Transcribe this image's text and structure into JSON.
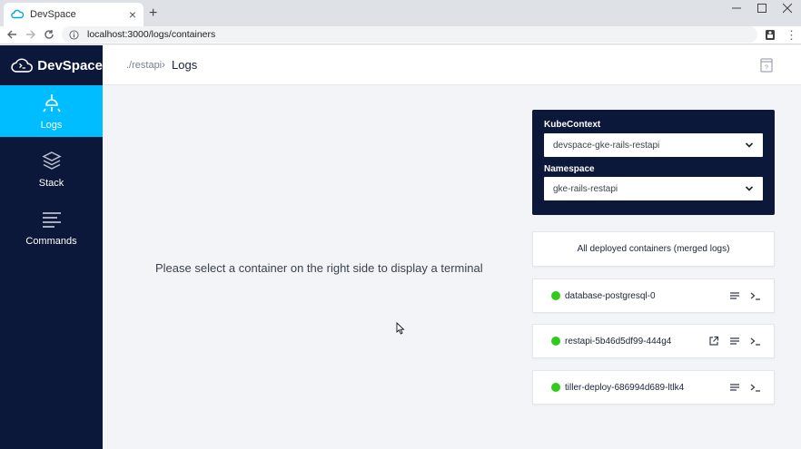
{
  "browser": {
    "tab_title": "DevSpace",
    "new_tab": "+",
    "url": "localhost:3000/logs/containers",
    "window_controls": [
      "minimize",
      "maximize",
      "close"
    ]
  },
  "app": {
    "brand": "DevSpace",
    "breadcrumb": {
      "parent": "./restapi",
      "separator": "›",
      "current": "Logs"
    },
    "sidebar": {
      "items": [
        {
          "label": "Logs",
          "icon": "logs-icon",
          "active": true
        },
        {
          "label": "Stack",
          "icon": "stack-icon",
          "active": false
        },
        {
          "label": "Commands",
          "icon": "commands-icon",
          "active": false
        }
      ]
    },
    "main": {
      "message": "Please select a container on the right side to display a terminal"
    },
    "context_panel": {
      "kube_label": "KubeContext",
      "kube_value": "devspace-gke-rails-restapi",
      "ns_label": "Namespace",
      "ns_value": "gke-rails-restapi"
    },
    "containers": {
      "all_label": "All deployed containers (merged logs)",
      "items": [
        {
          "name": "database-postgresql-0",
          "status_color": "#2fcc1c",
          "open_link": false
        },
        {
          "name": "restapi-5b46d5df99-444g4",
          "status_color": "#2fcc1c",
          "open_link": true
        },
        {
          "name": "tiller-deploy-686994d689-ltlk4",
          "status_color": "#2fcc1c",
          "open_link": false
        }
      ]
    }
  },
  "colors": {
    "sidebar_bg": "#0c1839",
    "active_accent": "#00bdff",
    "status_green": "#2fcc1c"
  }
}
